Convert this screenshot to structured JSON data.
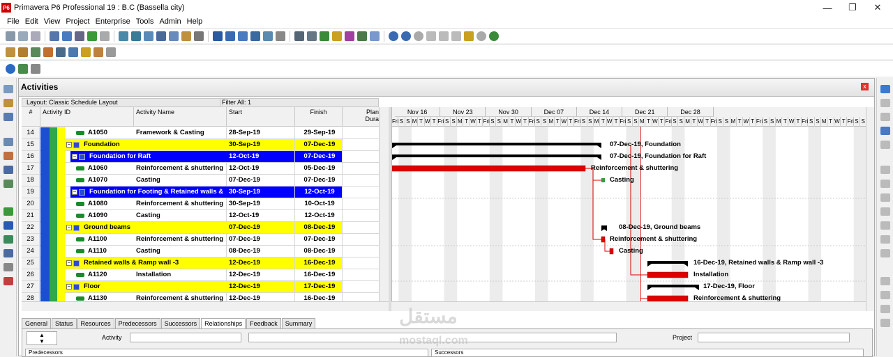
{
  "app": {
    "logo": "P6",
    "title": "Primavera P6 Professional 19 : B.C (Bassella city)",
    "icon": "p6-logo-icon"
  },
  "window_controls": {
    "minimize": "—",
    "maximize": "❐",
    "close": "✕"
  },
  "menu": [
    "File",
    "Edit",
    "View",
    "Project",
    "Enterprise",
    "Tools",
    "Admin",
    "Help"
  ],
  "panel": {
    "title": "Activities",
    "close": "x"
  },
  "layout_label": "Layout: Classic Schedule Layout",
  "filter_label": "Filter All: 1",
  "columns": {
    "num": "#",
    "id": "Activity ID",
    "name": "Activity Name",
    "start": "Start",
    "finish": "Finish",
    "plan": "Plan",
    "dura": "Dura"
  },
  "rows": [
    {
      "n": "14",
      "type": "task",
      "id": "A1050",
      "name": "Framework & Casting",
      "start": "28-Sep-19",
      "finish": "29-Sep-19"
    },
    {
      "n": "15",
      "type": "wbs1",
      "id": "Foundation",
      "start": "30-Sep-19",
      "finish": "07-Dec-19"
    },
    {
      "n": "16",
      "type": "wbs2",
      "id": "Foundation for Raft",
      "start": "12-Oct-19",
      "finish": "07-Dec-19"
    },
    {
      "n": "17",
      "type": "task",
      "id": "A1060",
      "name": "Reinforcement & shuttering",
      "start": "12-Oct-19",
      "finish": "05-Dec-19"
    },
    {
      "n": "18",
      "type": "task",
      "id": "A1070",
      "name": "Casting",
      "start": "07-Dec-19",
      "finish": "07-Dec-19"
    },
    {
      "n": "19",
      "type": "wbs2",
      "id": "Foundation for Footing & Retained walls &",
      "start": "30-Sep-19",
      "finish": "12-Oct-19"
    },
    {
      "n": "20",
      "type": "task",
      "id": "A1080",
      "name": "Reinforcement & shuttering",
      "start": "30-Sep-19",
      "finish": "10-Oct-19"
    },
    {
      "n": "21",
      "type": "task",
      "id": "A1090",
      "name": "Casting",
      "start": "12-Oct-19",
      "finish": "12-Oct-19"
    },
    {
      "n": "22",
      "type": "wbs1",
      "id": "Ground beams",
      "start": "07-Dec-19",
      "finish": "08-Dec-19"
    },
    {
      "n": "23",
      "type": "task",
      "id": "A1100",
      "name": "Reinforcement & shuttering",
      "start": "07-Dec-19",
      "finish": "07-Dec-19"
    },
    {
      "n": "24",
      "type": "task",
      "id": "A1110",
      "name": "Casting",
      "start": "08-Dec-19",
      "finish": "08-Dec-19"
    },
    {
      "n": "25",
      "type": "wbs1",
      "id": "Retained walls & Ramp wall -3",
      "start": "12-Dec-19",
      "finish": "16-Dec-19"
    },
    {
      "n": "26",
      "type": "task",
      "id": "A1120",
      "name": "Installation",
      "start": "12-Dec-19",
      "finish": "16-Dec-19"
    },
    {
      "n": "27",
      "type": "wbs1",
      "id": "Floor",
      "start": "12-Dec-19",
      "finish": "17-Dec-19"
    },
    {
      "n": "28",
      "type": "task",
      "id": "A1130",
      "name": "Reinforcement & shuttering",
      "start": "12-Dec-19",
      "finish": "16-Dec-19"
    }
  ],
  "timeline": {
    "weeks": [
      "Nov 16",
      "Nov 23",
      "Nov 30",
      "Dec 07",
      "Dec 14",
      "Dec 21",
      "Dec 28"
    ],
    "day_letters": [
      "Fri",
      "S",
      "S",
      "M",
      "T",
      "W",
      "T"
    ]
  },
  "gantt_labels": [
    {
      "row": 1,
      "text": "07-Dec-19, Foundation"
    },
    {
      "row": 2,
      "text": "07-Dec-19, Foundation for Raft"
    },
    {
      "row": 3,
      "text": "Reinforcement & shuttering"
    },
    {
      "row": 4,
      "text": "Casting"
    },
    {
      "row": 8,
      "text": "08-Dec-19, Ground beams"
    },
    {
      "row": 9,
      "text": "Reinforcement & shuttering"
    },
    {
      "row": 10,
      "text": "Casting"
    },
    {
      "row": 11,
      "text": "16-Dec-19, Retained walls & Ramp wall -3"
    },
    {
      "row": 12,
      "text": "Installation"
    },
    {
      "row": 13,
      "text": "17-Dec-19, Floor"
    },
    {
      "row": 14,
      "text": "Reinforcement & shuttering"
    }
  ],
  "detail_tabs": [
    "General",
    "Status",
    "Resources",
    "Predecessors",
    "Successors",
    "Relationships",
    "Feedback",
    "Summary"
  ],
  "active_tab": "Relationships",
  "details": {
    "activity_label": "Activity",
    "project_label": "Project",
    "predecessors": "Predecessors",
    "successors": "Successors"
  },
  "watermark": {
    "arabic": "مستقل",
    "latin": "mostaql.com"
  },
  "colors": {
    "wbs1": "#ffff00",
    "wbs2": "#0000ff",
    "task_bar": "#e00000",
    "summary_bar": "#000000",
    "band_blue": "#1c4fd0",
    "band_green": "#2ea84a",
    "band_yellow": "#ffff00"
  }
}
